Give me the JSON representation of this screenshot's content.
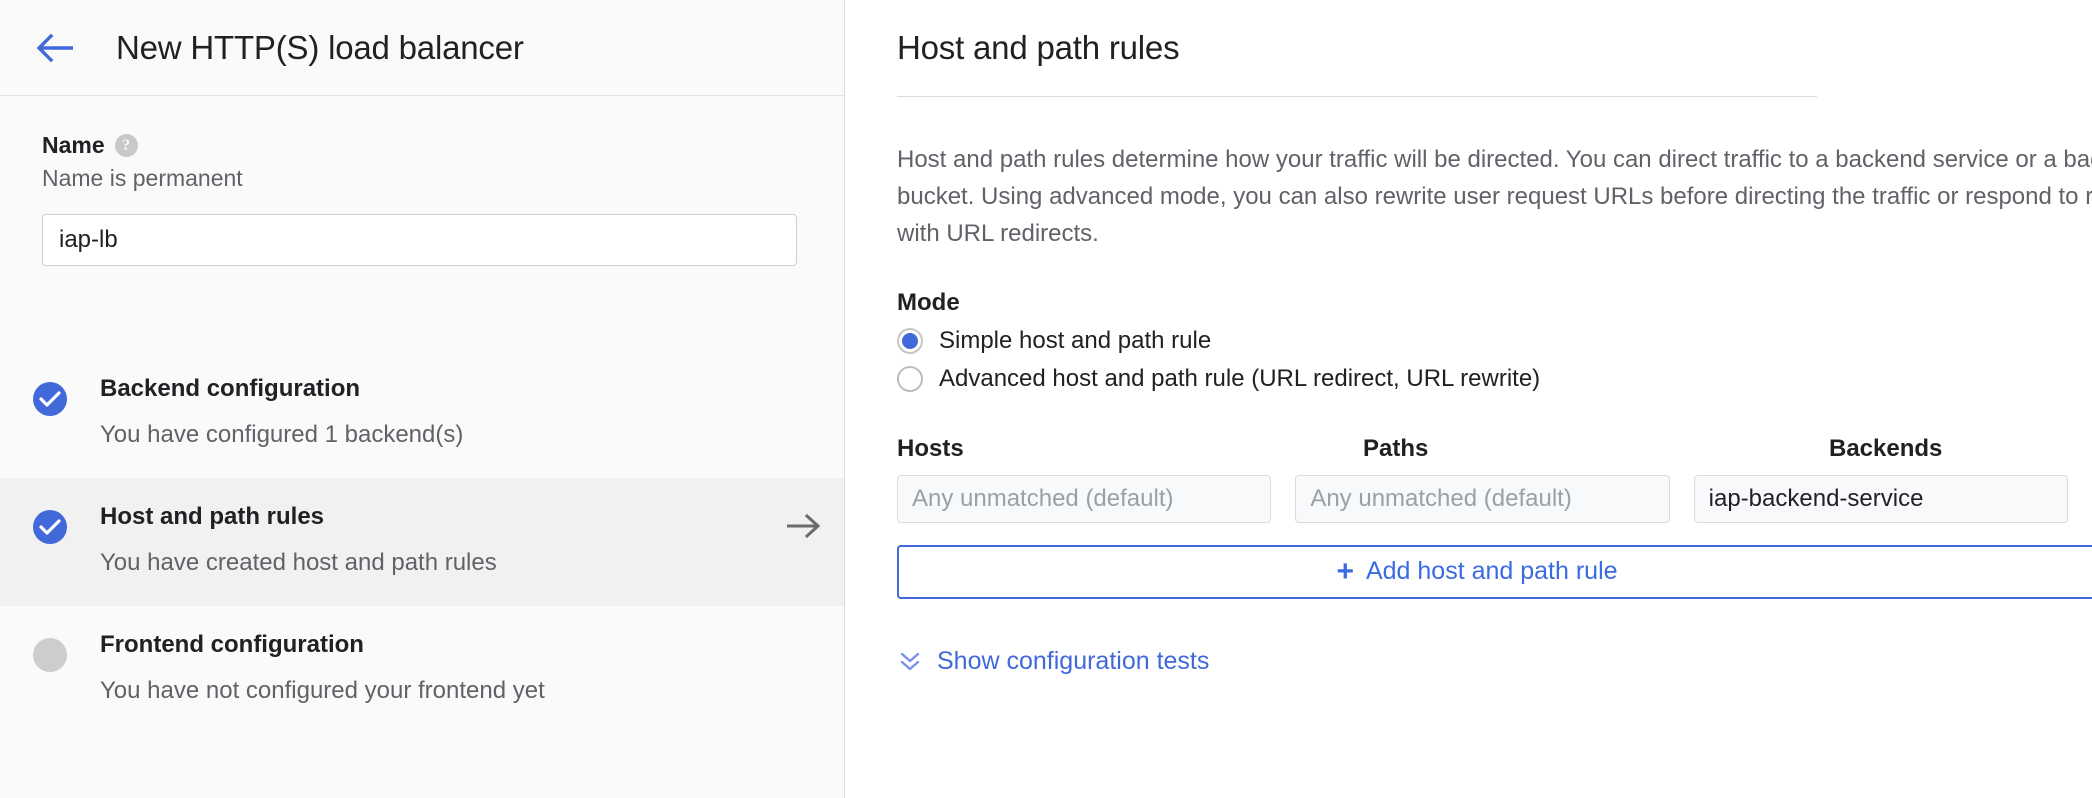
{
  "left": {
    "back_icon": "arrow-left-icon",
    "title": "New HTTP(S) load balancer",
    "name_section": {
      "label": "Name",
      "help_icon": "help-icon",
      "help_glyph": "?",
      "sublabel": "Name is permanent",
      "value": "iap-lb",
      "placeholder": ""
    },
    "steps": [
      {
        "id": "backend-configuration",
        "title": "Backend configuration",
        "desc": "You have configured 1 backend(s)",
        "state": "complete",
        "icon": "check-circle-icon",
        "active": false,
        "arrow": false
      },
      {
        "id": "host-and-path-rules",
        "title": "Host and path rules",
        "desc": "You have created host and path rules",
        "state": "complete",
        "icon": "check-circle-icon",
        "active": true,
        "arrow": true
      },
      {
        "id": "frontend-configuration",
        "title": "Frontend configuration",
        "desc": "You have not configured your frontend yet",
        "state": "incomplete",
        "icon": "empty-circle-icon",
        "active": false,
        "arrow": false
      }
    ]
  },
  "right": {
    "title": "Host and path rules",
    "description_lines": [
      "Host and path rules determine how your traffic will be directed. You can direct traffic to a backend service or a backend",
      "bucket. Using advanced mode, you can also rewrite user request URLs before directing the traffic or respond to requests",
      "with URL redirects."
    ],
    "mode": {
      "label": "Mode",
      "options": [
        {
          "id": "simple",
          "label": "Simple host and path rule",
          "selected": true
        },
        {
          "id": "advanced",
          "label": "Advanced host and path rule (URL redirect, URL rewrite)",
          "selected": false
        }
      ]
    },
    "table": {
      "headers": {
        "hosts": "Hosts",
        "paths": "Paths",
        "backends": "Backends"
      },
      "rows": [
        {
          "hosts_placeholder": "Any unmatched (default)",
          "hosts_value": "",
          "paths_placeholder": "Any unmatched (default)",
          "paths_value": "",
          "backends_value": "iap-backend-service"
        }
      ]
    },
    "add_rule": {
      "icon": "plus-icon",
      "glyph": "+",
      "label": "Add host and path rule"
    },
    "show_tests": {
      "icon": "double-chevron-down-icon",
      "label": "Show configuration tests"
    }
  },
  "colors": {
    "accent_blue": "#4169d9",
    "link_blue": "#3b6be0",
    "text_primary": "#202124",
    "text_secondary": "#5f6368",
    "panel_bg": "#fafafa",
    "active_row": "#f1f1f1"
  }
}
